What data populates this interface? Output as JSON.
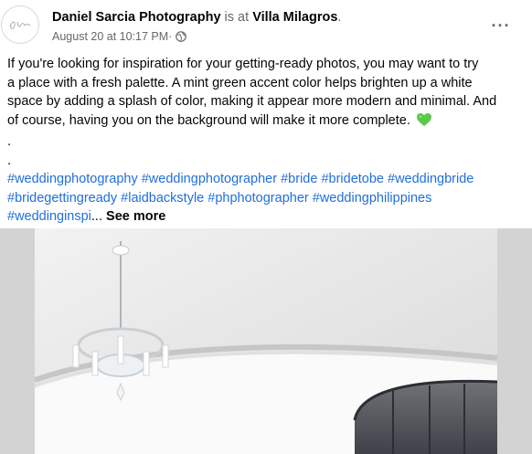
{
  "post": {
    "author": "Daniel Sarcia Photography",
    "connector": " is at ",
    "location": "Villa Milagros",
    "location_end": ".",
    "date": "August 20 at 10:17 PM",
    "separator": " · ",
    "privacy_icon": "globe-icon",
    "more_icon": "more-options-icon",
    "more_label": "···",
    "text_lines": [
      "If you're looking for inspiration for your getting-ready photos,  you may want to try",
      "a place with a fresh palette. A mint green accent color helps brighten up a white",
      "space by adding a splash of color, making it appear more modern and minimal. And",
      "of course, having you on the background will make it more complete."
    ],
    "emoji_icon": "green-heart-icon",
    "dot_lines": [
      ".",
      "."
    ],
    "hashtags": [
      "#weddingphotography",
      "#weddingphotographer",
      "#bride",
      "#bridetobe",
      "#weddingbride",
      "#bridegettingready",
      "#laidbackstyle",
      "#phphotographer",
      "#weddingphilippines"
    ],
    "truncated_tag": "#weddinginspi",
    "ellipsis": "...",
    "see_more": "See more"
  },
  "colors": {
    "link": "#216fdb",
    "secondary_text": "#65676b",
    "heart": "#5ac84a",
    "photo_wall": "#d3d3d3"
  }
}
